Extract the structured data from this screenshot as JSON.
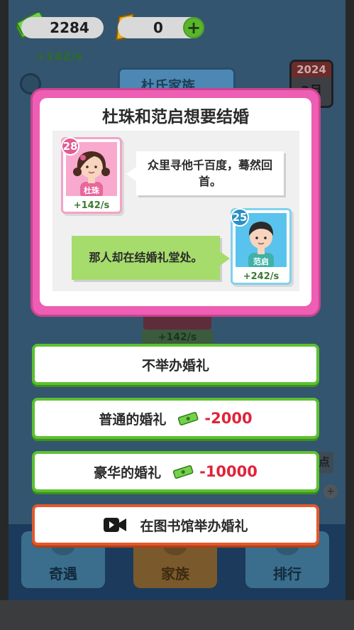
{
  "hud": {
    "cash": "2284",
    "gold": "0",
    "plus_symbol": "+",
    "income_rate": "+142/s",
    "family_banner": "杜氏家族",
    "calendar_year": "2024",
    "calendar_month": "3月"
  },
  "background": {
    "character_rate": "+142/s",
    "side_tag": "点",
    "small_plus": "+"
  },
  "dialog": {
    "title": "杜珠和范启想要结婚",
    "female": {
      "age": "28",
      "name": "杜珠",
      "rate": "+142/s"
    },
    "male": {
      "age": "25",
      "name": "范启",
      "rate": "+242/s"
    },
    "message_left": "众里寻他千百度，蓦然回首。",
    "message_right": "那人却在结婚礼堂处。"
  },
  "options": [
    {
      "label": "不举办婚礼"
    },
    {
      "label": "普通的婚礼",
      "cost": "-2000"
    },
    {
      "label": "豪华的婚礼",
      "cost": "-10000"
    },
    {
      "label": "在图书馆举办婚礼"
    }
  ],
  "bottom_nav": [
    {
      "label": "奇遇",
      "icon": "compass-icon"
    },
    {
      "label": "家族",
      "icon": "family-icon"
    },
    {
      "label": "排行",
      "icon": "ranking-icon"
    }
  ],
  "colors": {
    "dialog_border": "#ee5eb4",
    "option_border": "#5cc031",
    "video_option_border": "#e2592c",
    "cost_text": "#e0243a",
    "bubble_green": "#a5dc6c"
  }
}
